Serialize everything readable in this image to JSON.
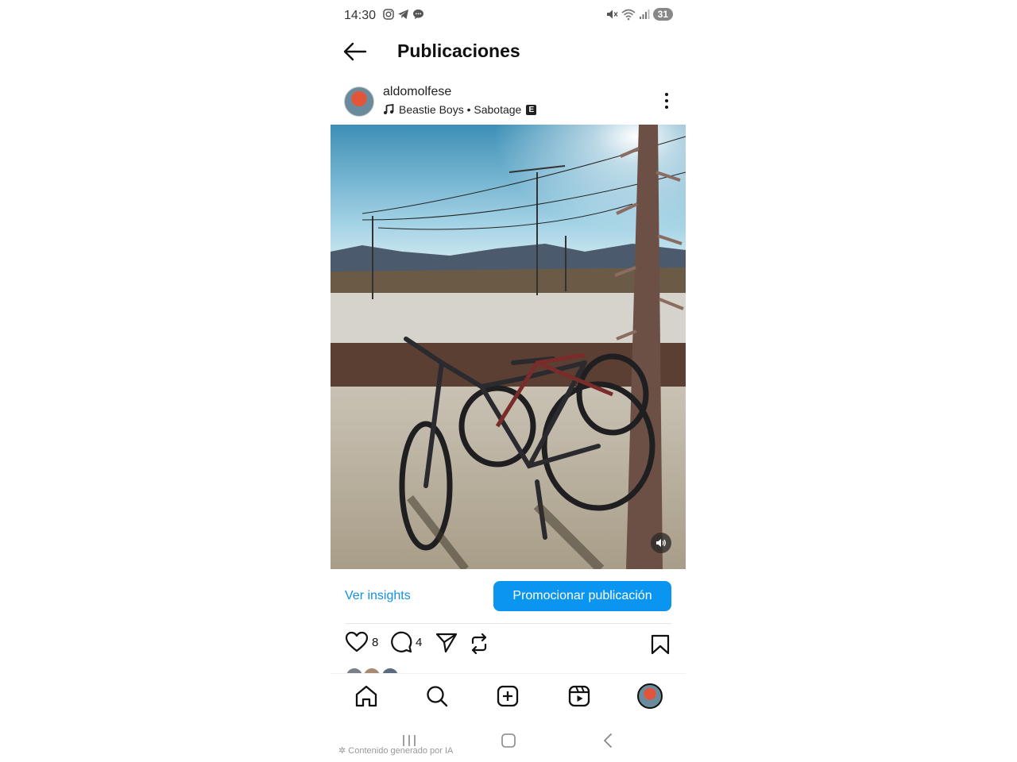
{
  "status_bar": {
    "time": "14:30",
    "battery": "31"
  },
  "header": {
    "title": "Publicaciones"
  },
  "post": {
    "username": "aldomolfese",
    "song": "Beastie Boys • Sabotage",
    "explicit_badge": "E",
    "insights_label": "Ver insights",
    "promote_label": "Promocionar publicación",
    "likes_count": "8",
    "comments_count": "4"
  },
  "footer": {
    "ai_label": "Contenido generado por IA"
  },
  "colors": {
    "accent": "#0a95f0",
    "link": "#1490e0"
  }
}
